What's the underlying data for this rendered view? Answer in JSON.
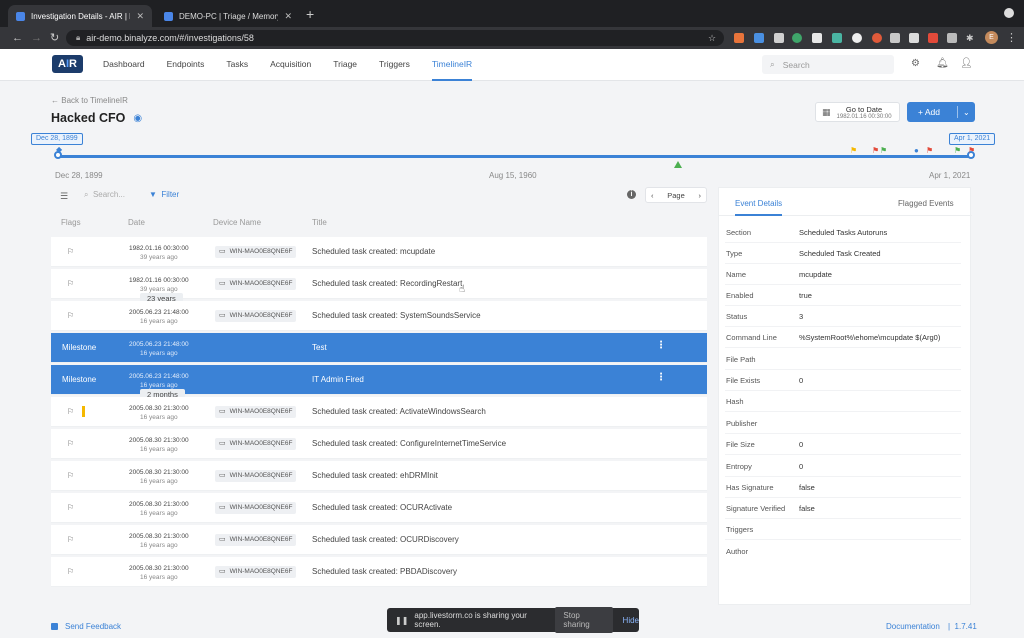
{
  "browser": {
    "tabs": [
      {
        "title": "Investigation Details - AIR | Bin",
        "active": true
      },
      {
        "title": "DEMO-PC | Triage / Memory | Y",
        "active": false
      }
    ],
    "url": "air-demo.binalyze.com/#/investigations/58",
    "profile_initial": "E"
  },
  "app": {
    "logo": "AIR",
    "nav": [
      "Dashboard",
      "Endpoints",
      "Tasks",
      "Acquisition",
      "Triage",
      "Triggers",
      "TimelineIR"
    ],
    "active_nav": "TimelineIR",
    "search_placeholder": "Search"
  },
  "page": {
    "back_label": "Back to TimelineIR",
    "title": "Hacked CFO",
    "goto_date_label": "Go to Date",
    "goto_date_value": "1982.01.16 00:30:00",
    "add_label": "Add"
  },
  "timeline": {
    "start_chip": "Dec 28, 1899",
    "end_chip": "Apr 1, 2021",
    "labels": {
      "start": "Dec 28, 1899",
      "middle": "Aug 15, 1960",
      "end": "Apr 1, 2021"
    }
  },
  "toolbar": {
    "search_placeholder": "Search...",
    "filter_label": "Filter",
    "page_label": "Page"
  },
  "table": {
    "columns": [
      "Flags",
      "Date",
      "Device Name",
      "Title"
    ],
    "rows": [
      {
        "type": "event",
        "date": "1982.01.16 00:30:00",
        "ago": "39 years ago",
        "device": "WIN-MAO0E8QNE6F",
        "title": "Scheduled task created: mcupdate"
      },
      {
        "type": "event",
        "date": "1982.01.16 00:30:00",
        "ago": "39 years ago",
        "device": "WIN-MAO0E8QNE6F",
        "title": "Scheduled task created: RecordingRestart"
      },
      {
        "type": "event",
        "date": "2005.06.23 21:48:00",
        "ago": "16 years ago",
        "device": "WIN-MAO0E8QNE6F",
        "title": "Scheduled task created: SystemSoundsService"
      },
      {
        "type": "milestone",
        "label": "Milestone",
        "date": "2005.06.23 21:48:00",
        "ago": "16 years ago",
        "title": "Test"
      },
      {
        "type": "milestone",
        "label": "Milestone",
        "date": "2005.06.23 21:48:00",
        "ago": "16 years ago",
        "title": "IT Admin Fired"
      },
      {
        "type": "event",
        "date": "2005.08.30 21:30:00",
        "ago": "16 years ago",
        "device": "WIN-MAO0E8QNE6F",
        "title": "Scheduled task created: ActivateWindowsSearch"
      },
      {
        "type": "event",
        "date": "2005.08.30 21:30:00",
        "ago": "16 years ago",
        "device": "WIN-MAO0E8QNE6F",
        "title": "Scheduled task created: ConfigureInternetTimeService"
      },
      {
        "type": "event",
        "date": "2005.08.30 21:30:00",
        "ago": "16 years ago",
        "device": "WIN-MAO0E8QNE6F",
        "title": "Scheduled task created: ehDRMInit"
      },
      {
        "type": "event",
        "date": "2005.08.30 21:30:00",
        "ago": "16 years ago",
        "device": "WIN-MAO0E8QNE6F",
        "title": "Scheduled task created: OCURActivate"
      },
      {
        "type": "event",
        "date": "2005.08.30 21:30:00",
        "ago": "16 years ago",
        "device": "WIN-MAO0E8QNE6F",
        "title": "Scheduled task created: OCURDiscovery"
      },
      {
        "type": "event",
        "date": "2005.08.30 21:30:00",
        "ago": "16 years ago",
        "device": "WIN-MAO0E8QNE6F",
        "title": "Scheduled task created: PBDADiscovery"
      }
    ],
    "gap_labels": [
      "23 years",
      "2 months"
    ]
  },
  "details": {
    "tabs": [
      "Event Details",
      "Flagged Events"
    ],
    "active_tab": "Event Details",
    "fields": [
      {
        "key": "Section",
        "value": "Scheduled Tasks Autoruns"
      },
      {
        "key": "Type",
        "value": "Scheduled Task Created"
      },
      {
        "key": "Name",
        "value": "mcupdate"
      },
      {
        "key": "Enabled",
        "value": "true"
      },
      {
        "key": "Status",
        "value": "3"
      },
      {
        "key": "Command Line",
        "value": "%SystemRoot%\\ehome\\mcupdate $(Arg0)"
      },
      {
        "key": "File Path",
        "value": ""
      },
      {
        "key": "File Exists",
        "value": "0"
      },
      {
        "key": "Hash",
        "value": ""
      },
      {
        "key": "Publisher",
        "value": ""
      },
      {
        "key": "File Size",
        "value": "0"
      },
      {
        "key": "Entropy",
        "value": "0"
      },
      {
        "key": "Has Signature",
        "value": "false"
      },
      {
        "key": "Signature Verified",
        "value": "false"
      },
      {
        "key": "Triggers",
        "value": ""
      },
      {
        "key": "Author",
        "value": ""
      }
    ]
  },
  "footer": {
    "feedback": "Send Feedback",
    "documentation": "Documentation",
    "version": "1.7.41"
  },
  "share_bar": {
    "message": "app.livestorm.co is sharing your screen.",
    "stop_label": "Stop sharing",
    "hide_label": "Hide"
  },
  "colors": {
    "accent": "#3b82d6",
    "milestone_bg": "#3b82d6",
    "flag_yellow": "#f5b800"
  }
}
